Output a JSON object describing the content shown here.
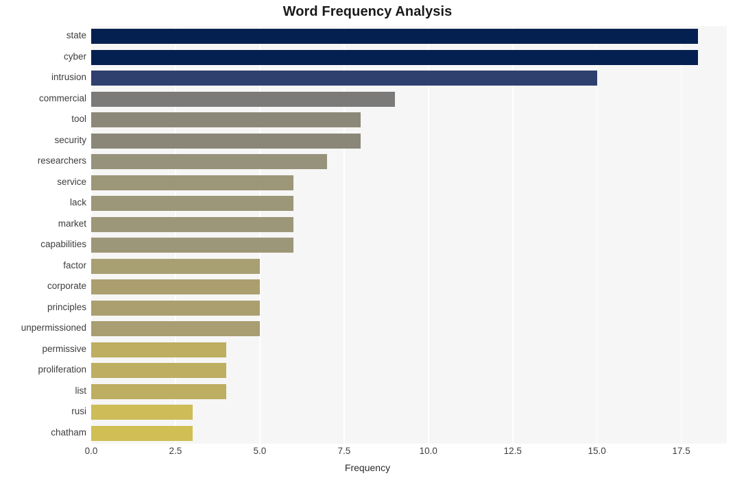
{
  "chart_data": {
    "type": "bar",
    "orientation": "horizontal",
    "title": "Word Frequency Analysis",
    "xlabel": "Frequency",
    "ylabel": "",
    "xlim": [
      0,
      18.85
    ],
    "xticks": [
      "0.0",
      "2.5",
      "5.0",
      "7.5",
      "10.0",
      "12.5",
      "15.0",
      "17.5"
    ],
    "xtick_values": [
      0,
      2.5,
      5,
      7.5,
      10,
      12.5,
      15,
      17.5
    ],
    "grid": "vertical-white-on-gray",
    "legend": "none",
    "categories": [
      "state",
      "cyber",
      "intrusion",
      "commercial",
      "tool",
      "security",
      "researchers",
      "service",
      "lack",
      "market",
      "capabilities",
      "factor",
      "corporate",
      "principles",
      "unpermissioned",
      "permissive",
      "proliferation",
      "list",
      "rusi",
      "chatham"
    ],
    "values": [
      18,
      18,
      15,
      9,
      8,
      8,
      7,
      6,
      6,
      6,
      6,
      5,
      5,
      5,
      5,
      4,
      4,
      4,
      3,
      3
    ],
    "bar_colors": [
      "#042050",
      "#042050",
      "#2f3f6e",
      "#7b7a78",
      "#8b8879",
      "#8a8779",
      "#97927c",
      "#9d9779",
      "#9d9779",
      "#9d9779",
      "#9d9779",
      "#a89f73",
      "#ab9f6f",
      "#ab9f6f",
      "#a99e72",
      "#bdae62",
      "#bdae62",
      "#bdae62",
      "#cdbc57",
      "#d0bf55"
    ]
  },
  "colors": {
    "plot_background": "#f6f6f6",
    "gridline": "#ffffff",
    "title_text": "#1a1a1a",
    "tick_text": "#3d3d3d",
    "page_background": "#ffffff"
  }
}
